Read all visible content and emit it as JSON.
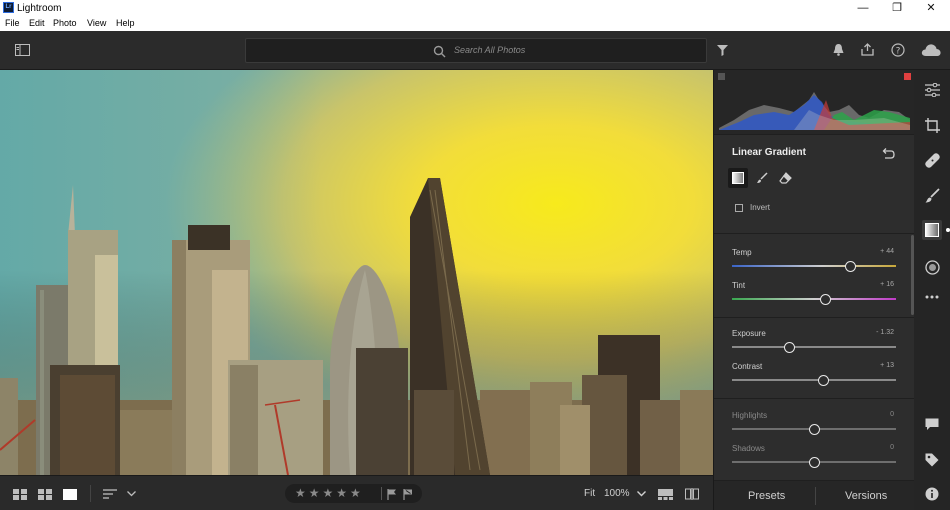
{
  "window": {
    "title": "Lightroom",
    "app_icon_text": "Lr",
    "minimize": "—",
    "maximize": "❐",
    "close": "✕"
  },
  "menu": [
    "File",
    "Edit",
    "Photo",
    "View",
    "Help"
  ],
  "search": {
    "placeholder": "Search All Photos"
  },
  "edit_panel": {
    "title": "Linear Gradient",
    "invert_label": "Invert",
    "sliders": [
      {
        "label": "Temp",
        "value": "+ 44",
        "position": 0.72
      },
      {
        "label": "Tint",
        "value": "+ 16",
        "position": 0.57
      },
      {
        "label": "Exposure",
        "value": "- 1.32",
        "position": 0.35
      },
      {
        "label": "Contrast",
        "value": "+ 13",
        "position": 0.56
      },
      {
        "label": "Highlights",
        "value": "0",
        "position": 0.5
      },
      {
        "label": "Shadows",
        "value": "0",
        "position": 0.5
      }
    ]
  },
  "panel_tabs": {
    "presets": "Presets",
    "versions": "Versions"
  },
  "bottom": {
    "fit": "Fit",
    "zoom": "100%"
  },
  "colors": {
    "accent": "#ffffff",
    "photo_yellow": "#f4e21a",
    "photo_teal": "#6fb3a6"
  }
}
